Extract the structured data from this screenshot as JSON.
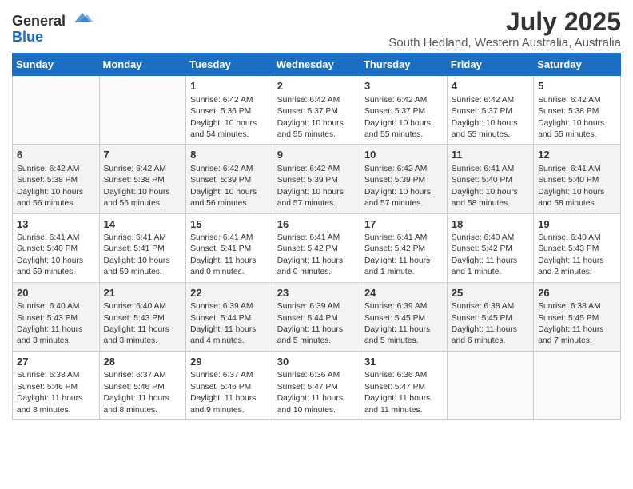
{
  "logo": {
    "general": "General",
    "blue": "Blue"
  },
  "title": {
    "month": "July 2025",
    "location": "South Hedland, Western Australia, Australia"
  },
  "weekdays": [
    "Sunday",
    "Monday",
    "Tuesday",
    "Wednesday",
    "Thursday",
    "Friday",
    "Saturday"
  ],
  "weeks": [
    [
      {
        "day": "",
        "info": ""
      },
      {
        "day": "",
        "info": ""
      },
      {
        "day": "1",
        "info": "Sunrise: 6:42 AM\nSunset: 5:36 PM\nDaylight: 10 hours and 54 minutes."
      },
      {
        "day": "2",
        "info": "Sunrise: 6:42 AM\nSunset: 5:37 PM\nDaylight: 10 hours and 55 minutes."
      },
      {
        "day": "3",
        "info": "Sunrise: 6:42 AM\nSunset: 5:37 PM\nDaylight: 10 hours and 55 minutes."
      },
      {
        "day": "4",
        "info": "Sunrise: 6:42 AM\nSunset: 5:37 PM\nDaylight: 10 hours and 55 minutes."
      },
      {
        "day": "5",
        "info": "Sunrise: 6:42 AM\nSunset: 5:38 PM\nDaylight: 10 hours and 55 minutes."
      }
    ],
    [
      {
        "day": "6",
        "info": "Sunrise: 6:42 AM\nSunset: 5:38 PM\nDaylight: 10 hours and 56 minutes."
      },
      {
        "day": "7",
        "info": "Sunrise: 6:42 AM\nSunset: 5:38 PM\nDaylight: 10 hours and 56 minutes."
      },
      {
        "day": "8",
        "info": "Sunrise: 6:42 AM\nSunset: 5:39 PM\nDaylight: 10 hours and 56 minutes."
      },
      {
        "day": "9",
        "info": "Sunrise: 6:42 AM\nSunset: 5:39 PM\nDaylight: 10 hours and 57 minutes."
      },
      {
        "day": "10",
        "info": "Sunrise: 6:42 AM\nSunset: 5:39 PM\nDaylight: 10 hours and 57 minutes."
      },
      {
        "day": "11",
        "info": "Sunrise: 6:41 AM\nSunset: 5:40 PM\nDaylight: 10 hours and 58 minutes."
      },
      {
        "day": "12",
        "info": "Sunrise: 6:41 AM\nSunset: 5:40 PM\nDaylight: 10 hours and 58 minutes."
      }
    ],
    [
      {
        "day": "13",
        "info": "Sunrise: 6:41 AM\nSunset: 5:40 PM\nDaylight: 10 hours and 59 minutes."
      },
      {
        "day": "14",
        "info": "Sunrise: 6:41 AM\nSunset: 5:41 PM\nDaylight: 10 hours and 59 minutes."
      },
      {
        "day": "15",
        "info": "Sunrise: 6:41 AM\nSunset: 5:41 PM\nDaylight: 11 hours and 0 minutes."
      },
      {
        "day": "16",
        "info": "Sunrise: 6:41 AM\nSunset: 5:42 PM\nDaylight: 11 hours and 0 minutes."
      },
      {
        "day": "17",
        "info": "Sunrise: 6:41 AM\nSunset: 5:42 PM\nDaylight: 11 hours and 1 minute."
      },
      {
        "day": "18",
        "info": "Sunrise: 6:40 AM\nSunset: 5:42 PM\nDaylight: 11 hours and 1 minute."
      },
      {
        "day": "19",
        "info": "Sunrise: 6:40 AM\nSunset: 5:43 PM\nDaylight: 11 hours and 2 minutes."
      }
    ],
    [
      {
        "day": "20",
        "info": "Sunrise: 6:40 AM\nSunset: 5:43 PM\nDaylight: 11 hours and 3 minutes."
      },
      {
        "day": "21",
        "info": "Sunrise: 6:40 AM\nSunset: 5:43 PM\nDaylight: 11 hours and 3 minutes."
      },
      {
        "day": "22",
        "info": "Sunrise: 6:39 AM\nSunset: 5:44 PM\nDaylight: 11 hours and 4 minutes."
      },
      {
        "day": "23",
        "info": "Sunrise: 6:39 AM\nSunset: 5:44 PM\nDaylight: 11 hours and 5 minutes."
      },
      {
        "day": "24",
        "info": "Sunrise: 6:39 AM\nSunset: 5:45 PM\nDaylight: 11 hours and 5 minutes."
      },
      {
        "day": "25",
        "info": "Sunrise: 6:38 AM\nSunset: 5:45 PM\nDaylight: 11 hours and 6 minutes."
      },
      {
        "day": "26",
        "info": "Sunrise: 6:38 AM\nSunset: 5:45 PM\nDaylight: 11 hours and 7 minutes."
      }
    ],
    [
      {
        "day": "27",
        "info": "Sunrise: 6:38 AM\nSunset: 5:46 PM\nDaylight: 11 hours and 8 minutes."
      },
      {
        "day": "28",
        "info": "Sunrise: 6:37 AM\nSunset: 5:46 PM\nDaylight: 11 hours and 8 minutes."
      },
      {
        "day": "29",
        "info": "Sunrise: 6:37 AM\nSunset: 5:46 PM\nDaylight: 11 hours and 9 minutes."
      },
      {
        "day": "30",
        "info": "Sunrise: 6:36 AM\nSunset: 5:47 PM\nDaylight: 11 hours and 10 minutes."
      },
      {
        "day": "31",
        "info": "Sunrise: 6:36 AM\nSunset: 5:47 PM\nDaylight: 11 hours and 11 minutes."
      },
      {
        "day": "",
        "info": ""
      },
      {
        "day": "",
        "info": ""
      }
    ]
  ]
}
